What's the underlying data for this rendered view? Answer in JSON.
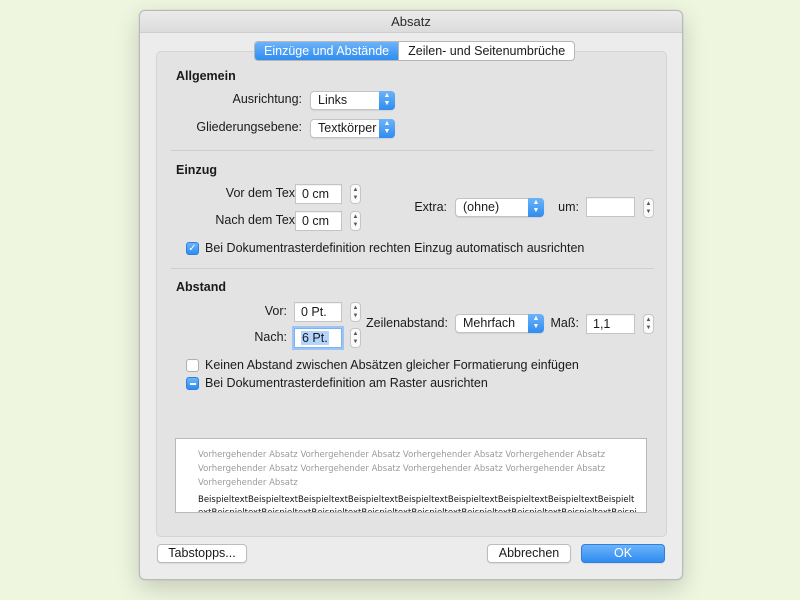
{
  "window": {
    "title": "Absatz"
  },
  "tabs": [
    {
      "label": "Einzüge und Abstände",
      "active": true
    },
    {
      "label": "Zeilen- und Seitenumbrüche",
      "active": false
    }
  ],
  "allgemein": {
    "heading": "Allgemein",
    "ausrichtung_label": "Ausrichtung:",
    "ausrichtung_value": "Links",
    "gliederung_label": "Gliederungsebene:",
    "gliederung_value": "Textkörper"
  },
  "einzug": {
    "heading": "Einzug",
    "vor_label": "Vor dem Text:",
    "vor_value": "0 cm",
    "nach_label": "Nach dem Text:",
    "nach_value": "0 cm",
    "extra_label": "Extra:",
    "extra_value": "(ohne)",
    "um_label": "um:",
    "um_value": "",
    "checkbox_label": "Bei Dokumentrasterdefinition rechten Einzug automatisch ausrichten",
    "checkbox_checked": true
  },
  "abstand": {
    "heading": "Abstand",
    "vor_label": "Vor:",
    "vor_value": "0 Pt.",
    "nach_label": "Nach:",
    "nach_value": "6 Pt.",
    "zeilenabstand_label": "Zeilenabstand:",
    "zeilenabstand_value": "Mehrfach",
    "mass_label": "Maß:",
    "mass_value": "1,1",
    "check1_label": "Keinen Abstand zwischen Absätzen gleicher Formatierung einfügen",
    "check1_checked": false,
    "check2_label": "Bei Dokumentrasterdefinition am Raster ausrichten",
    "check2_state": "mixed"
  },
  "preview": {
    "previous_text": "Vorhergehender Absatz Vorhergehender Absatz Vorhergehender Absatz Vorhergehender Absatz Vorhergehender Absatz Vorhergehender Absatz Vorhergehender Absatz Vorhergehender Absatz Vorhergehender Absatz",
    "sample_line1": "BeispieltextBeispieltextBeispieltextBeispieltextBeispieltextBeispieltextBeispieltextBeispieltextBeispielt",
    "sample_line2": "extBeispieltextBeispieltextBeispieltextBeispieltextBeispieltextBeispieltextBeispieltextBeispieltextBeispi"
  },
  "buttons": {
    "tabstopps": "Tabstopps...",
    "abbrechen": "Abbrechen",
    "ok": "OK"
  },
  "colors": {
    "accent": "#2f8cf0",
    "background": "#eef6e0"
  }
}
